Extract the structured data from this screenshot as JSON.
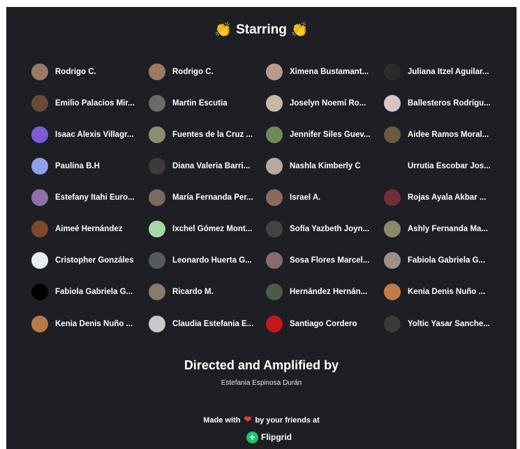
{
  "header": {
    "title": "Starring",
    "emoji_left": "👏",
    "emoji_right": "👏"
  },
  "cast": [
    {
      "name": "Rodrigo C.",
      "avatar_color": "#9a7a66"
    },
    {
      "name": "Rodrigo C.",
      "avatar_color": "#9a7a66"
    },
    {
      "name": "Ximena Bustamant...",
      "avatar_color": "#b99a8a"
    },
    {
      "name": "Juliana Itzel Aguilar...",
      "avatar_color": "#2c2c2c"
    },
    {
      "name": "Emilio Palacios Mir...",
      "avatar_color": "#6b4a3a"
    },
    {
      "name": "Martin Escutia",
      "avatar_color": "#6a6a6a"
    },
    {
      "name": "Joselyn Noemí Ro...",
      "avatar_color": "#c9b8a4"
    },
    {
      "name": "Ballesteros Rodrígu...",
      "avatar_color": "#d7c4c6"
    },
    {
      "name": "Isaac Alexis Villagr...",
      "avatar_color": "#7a5cd6"
    },
    {
      "name": "Fuentes de la Cruz ...",
      "avatar_color": "#8b8d72"
    },
    {
      "name": "Jennifer Siles Guev...",
      "avatar_color": "#6f8a5a"
    },
    {
      "name": "Aidee Ramos Moral...",
      "avatar_color": "#6b5a3f"
    },
    {
      "name": "Paulina B.H",
      "avatar_color": "#8fa2e8"
    },
    {
      "name": "Diana Valeria Barri...",
      "avatar_color": "#3e3a3a"
    },
    {
      "name": "Nashla Kimberly C",
      "avatar_color": "#b9a9a0"
    },
    {
      "name": "Urrutia Escobar Jos...",
      "avatar_color": ""
    },
    {
      "name": "Estefany Itahi Euro...",
      "avatar_color": "#8e73a6"
    },
    {
      "name": "María Fernanda Per...",
      "avatar_color": "#7a6a63"
    },
    {
      "name": "Israel A.",
      "avatar_color": "#8b6a5a"
    },
    {
      "name": "Rojas Ayala Akbar ...",
      "avatar_color": "#6e2f3a"
    },
    {
      "name": "Aimeé Hernández",
      "avatar_color": "#7a4a2a"
    },
    {
      "name": "Ixchel Gómez Mont...",
      "avatar_color": "#a6d8a6"
    },
    {
      "name": "Sofía Yazbeth Joyn...",
      "avatar_color": "#444444"
    },
    {
      "name": "Ashly Fernanda Ma...",
      "avatar_color": "#8a8a6a"
    },
    {
      "name": "Cristopher Gonzáles",
      "avatar_color": "#e9ecef"
    },
    {
      "name": "Leonardo Huerta G...",
      "avatar_color": "#555a5e"
    },
    {
      "name": "Sosa Flores Marcel...",
      "avatar_color": "#8a6b6d"
    },
    {
      "name": "Fabiola Gabriela G...",
      "avatar_color": "#9f8f8a"
    },
    {
      "name": "Fabiola Gabriela G...",
      "avatar_color": "#000000"
    },
    {
      "name": "Ricardo M.",
      "avatar_color": "#8a7a6a"
    },
    {
      "name": "Hernández Hernán...",
      "avatar_color": "#4e5a46"
    },
    {
      "name": "Kenia Denis Nuño ...",
      "avatar_color": "#c07a4a"
    },
    {
      "name": "Kenia Denis Nuño ...",
      "avatar_color": "#b87a4a"
    },
    {
      "name": "Claudia Estefania E...",
      "avatar_color": "#c8c8c8"
    },
    {
      "name": "Santiago Cordero",
      "avatar_color": "#c8161d"
    },
    {
      "name": "Yoltic Yasar Sanche...",
      "avatar_color": "#3a3a3a"
    }
  ],
  "credits": {
    "heading": "Directed and Amplified by",
    "director": "Estefania Espinosa Durán"
  },
  "footer": {
    "made_with": "Made with",
    "heart": "❤",
    "by_friends": "by your friends at",
    "brand": "Flipgrid",
    "brand_color": "#1cc46b"
  },
  "colors": {
    "background": "#1d1f24",
    "text": "#ffffff"
  }
}
